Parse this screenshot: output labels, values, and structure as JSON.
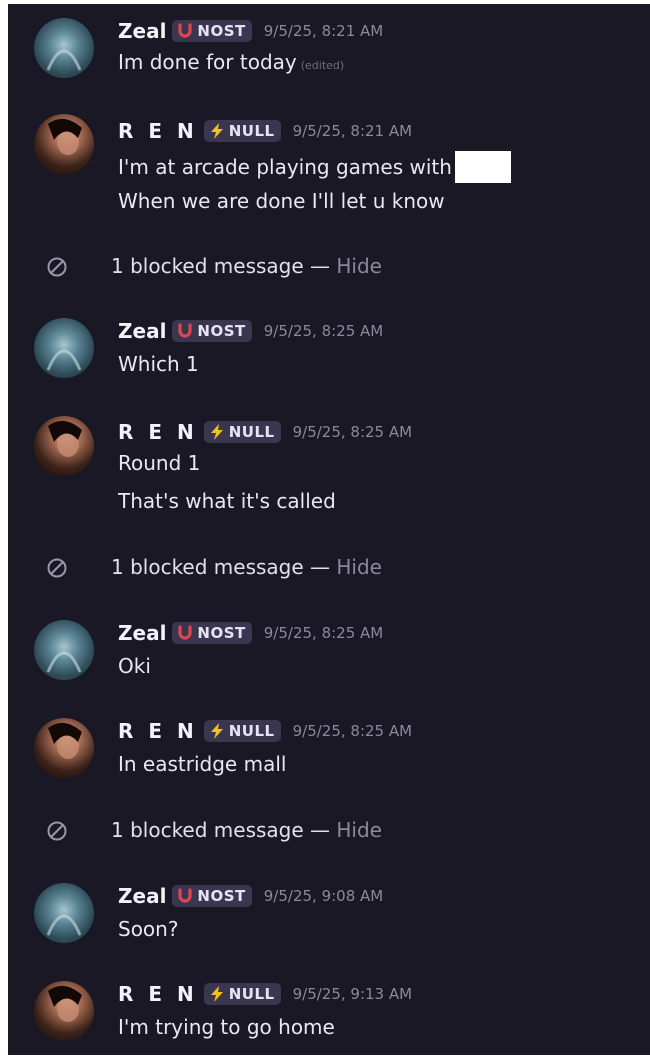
{
  "messages": [
    {
      "author": "Zeal",
      "tag": "NOST",
      "time": "9/5/25, 8:21 AM",
      "lines": [
        "Im done for today"
      ],
      "edited": "(edited)"
    },
    {
      "author": "R E N",
      "tag": "NULL",
      "time": "9/5/25, 8:21 AM",
      "lines": [
        "I'm at arcade playing games with",
        "When we are done I'll let u know"
      ]
    },
    {
      "author": "Zeal",
      "tag": "NOST",
      "time": "9/5/25, 8:25 AM",
      "lines": [
        "Which 1"
      ]
    },
    {
      "author": "R E N",
      "tag": "NULL",
      "time": "9/5/25, 8:25 AM",
      "lines": [
        "Round 1",
        "That's what it's called"
      ]
    },
    {
      "author": "Zeal",
      "tag": "NOST",
      "time": "9/5/25, 8:25 AM",
      "lines": [
        "Oki"
      ]
    },
    {
      "author": "R E N",
      "tag": "NULL",
      "time": "9/5/25, 8:25 AM",
      "lines": [
        "In eastridge mall"
      ]
    },
    {
      "author": "Zeal",
      "tag": "NOST",
      "time": "9/5/25, 9:08 AM",
      "lines": [
        "Soon?"
      ]
    },
    {
      "author": "R E N",
      "tag": "NULL",
      "time": "9/5/25, 9:13 AM",
      "lines": [
        "I'm trying to go home"
      ]
    }
  ],
  "blocked": {
    "text": "1 blocked message — ",
    "hide_label": "Hide"
  },
  "colors": {
    "background": "#1a1825",
    "tag_bg": "#3a3650",
    "nost_icon": "#e0444f",
    "null_icon": "#f4c21d",
    "muted": "#8c889c"
  },
  "icons": {
    "nost": "red-horseshoe-icon",
    "null": "lightning-bolt-icon",
    "blocked": "blocked-circle-icon"
  }
}
